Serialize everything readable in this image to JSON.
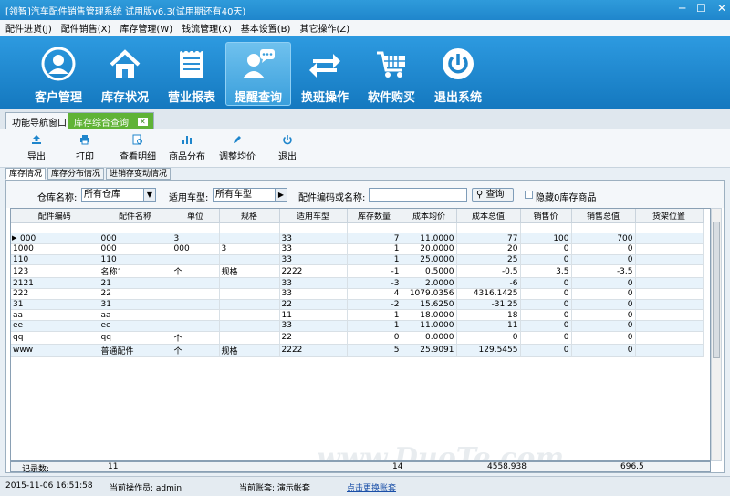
{
  "window": {
    "title": "[领智]汽车配件销售管理系统 试用版v6.3(试用期还有40天)"
  },
  "menu": [
    "配件进货(J)",
    "配件销售(X)",
    "库存管理(W)",
    "钱流管理(X)",
    "基本设置(B)",
    "其它操作(Z)"
  ],
  "big_buttons": [
    {
      "label": "客户管理",
      "icon": "customer-icon"
    },
    {
      "label": "库存状况",
      "icon": "warehouse-icon"
    },
    {
      "label": "营业报表",
      "icon": "report-icon"
    },
    {
      "label": "提醒查询",
      "icon": "reminder-icon"
    },
    {
      "label": "换班操作",
      "icon": "shift-change-icon"
    },
    {
      "label": "软件购买",
      "icon": "cart-icon"
    },
    {
      "label": "退出系统",
      "icon": "power-icon"
    }
  ],
  "tabs": {
    "nav": "功能导航窗口",
    "inventory": "库存综合查询"
  },
  "toolbar": {
    "export": "导出",
    "print": "打印",
    "detail": "查看明细",
    "distribution": "商品分布",
    "adjust": "调整均价",
    "exit": "退出"
  },
  "subtabs": [
    "库存情况",
    "库存分布情况",
    "进销存变动情况"
  ],
  "filter": {
    "warehouse_label": "仓库名称:",
    "warehouse_value": "所有仓库",
    "vehicle_label": "适用车型:",
    "vehicle_value": "所有车型",
    "code_label": "配件编码或名称:",
    "search_label": "查询",
    "hide_zero_label": "隐藏0库存商品"
  },
  "table": {
    "headers": [
      "配件编码",
      "配件名称",
      "单位",
      "规格",
      "适用车型",
      "库存数量",
      "成本均价",
      "成本总值",
      "销售价",
      "销售总值",
      "货架位置"
    ],
    "rows": [
      [
        "",
        "",
        "",
        "",
        "",
        "",
        "",
        "",
        "",
        "",
        ""
      ],
      [
        "000",
        "000",
        "3",
        "",
        "33",
        "7",
        "11.0000",
        "77",
        "100",
        "700",
        ""
      ],
      [
        "1000",
        "000",
        "000",
        "3",
        "33",
        "1",
        "20.0000",
        "20",
        "0",
        "0",
        ""
      ],
      [
        "110",
        "110",
        "",
        "",
        "33",
        "1",
        "25.0000",
        "25",
        "0",
        "0",
        ""
      ],
      [
        "123",
        "名称1",
        "个",
        "规格",
        "2222",
        "-1",
        "0.5000",
        "-0.5",
        "3.5",
        "-3.5",
        ""
      ],
      [
        "2121",
        "21",
        "",
        "",
        "33",
        "-3",
        "2.0000",
        "-6",
        "0",
        "0",
        ""
      ],
      [
        "222",
        "22",
        "",
        "",
        "33",
        "4",
        "1079.0356",
        "4316.1425",
        "0",
        "0",
        ""
      ],
      [
        "31",
        "31",
        "",
        "",
        "22",
        "-2",
        "15.6250",
        "-31.25",
        "0",
        "0",
        ""
      ],
      [
        "aa",
        "aa",
        "",
        "",
        "11",
        "1",
        "18.0000",
        "18",
        "0",
        "0",
        ""
      ],
      [
        "ee",
        "ee",
        "",
        "",
        "33",
        "1",
        "11.0000",
        "11",
        "0",
        "0",
        ""
      ],
      [
        "qq",
        "qq",
        "个",
        "",
        "22",
        "0",
        "0.0000",
        "0",
        "0",
        "0",
        ""
      ],
      [
        "www",
        "普通配件",
        "个",
        "规格",
        "2222",
        "5",
        "25.9091",
        "129.5455",
        "0",
        "0",
        ""
      ]
    ]
  },
  "summary": {
    "label": "记录数:",
    "count": "11",
    "qty_total": "14",
    "cost_total": "4558.938",
    "sales_total": "696.5"
  },
  "status": {
    "datetime": "2015-11-06 16:51:58",
    "operator": "当前操作员: admin",
    "account": "当前账套: 演示帐套",
    "switch": "点击更换账套"
  },
  "watermark": "www.DuoTe.com"
}
